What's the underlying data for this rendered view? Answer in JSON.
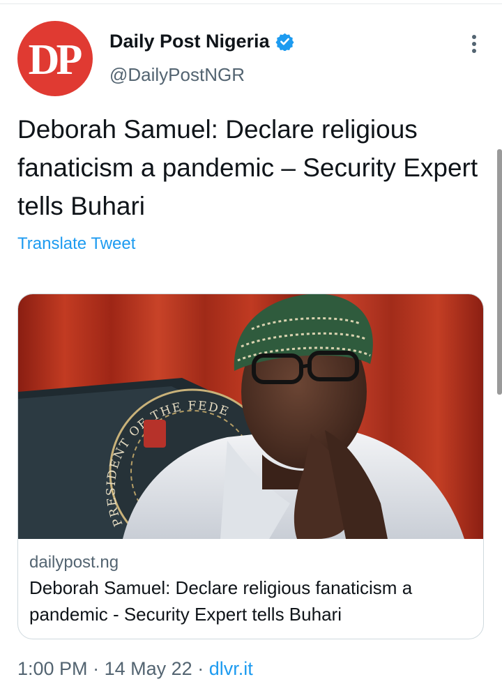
{
  "author": {
    "avatar_text": "DP",
    "name": "Daily Post Nigeria",
    "handle": "@DailyPostNGR",
    "verified": true
  },
  "tweet": {
    "text": "Deborah Samuel: Declare religious fanaticism a pandemic – Security Expert tells Buhari",
    "translate_label": "Translate Tweet"
  },
  "card": {
    "image": "photo-of-buhari-seated-with-presidential-seal",
    "seal_text": "PRESIDENT OF THE FEDERAL",
    "domain": "dailypost.ng",
    "title": "Deborah Samuel: Declare religious fanaticism a pandemic - Security Expert tells Buhari"
  },
  "meta": {
    "time": "1:00 PM",
    "date": "14 May 22",
    "separator": "·",
    "source": "dlvr.it"
  },
  "icons": {
    "verified": "verified-badge-icon",
    "more": "more-options-icon"
  },
  "colors": {
    "accent": "#1d9bf0",
    "avatar_bg": "#e03a32",
    "muted": "#536471"
  }
}
